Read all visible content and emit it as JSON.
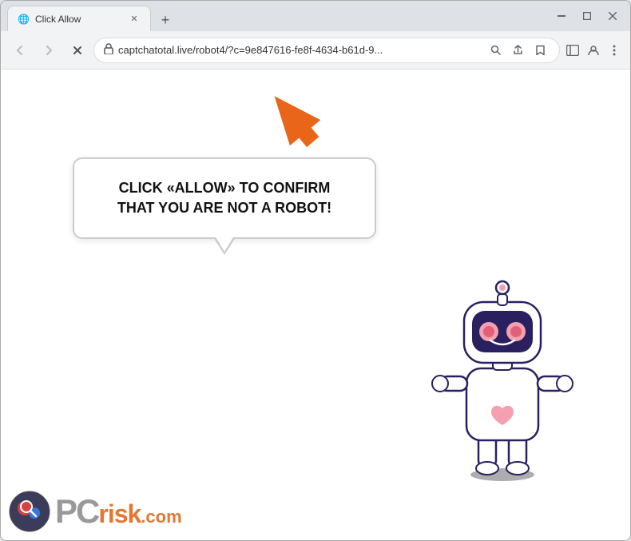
{
  "browser": {
    "tab": {
      "title": "Click Allow",
      "favicon": "🌐"
    },
    "new_tab_label": "+",
    "window_controls": {
      "minimize": "—",
      "maximize": "□",
      "close": "✕"
    },
    "toolbar": {
      "back_label": "←",
      "forward_label": "→",
      "reload_label": "✕",
      "url": "captchatotal.live/robot4/?c=9e847616-fe8f-4634-b61d-9...",
      "lock_icon": "🔒",
      "search_icon": "🔍",
      "share_icon": "⬆",
      "bookmark_icon": "☆",
      "sidebar_icon": "⬜",
      "profile_icon": "👤",
      "menu_icon": "⋮"
    }
  },
  "page": {
    "bubble_text": "CLICK «ALLOW» TO CONFIRM THAT YOU ARE NOT A ROBOT!",
    "arrow_color": "#e8651a"
  },
  "watermark": {
    "pc_text": "PC",
    "risk_text": "risk",
    "domain": ".com"
  }
}
